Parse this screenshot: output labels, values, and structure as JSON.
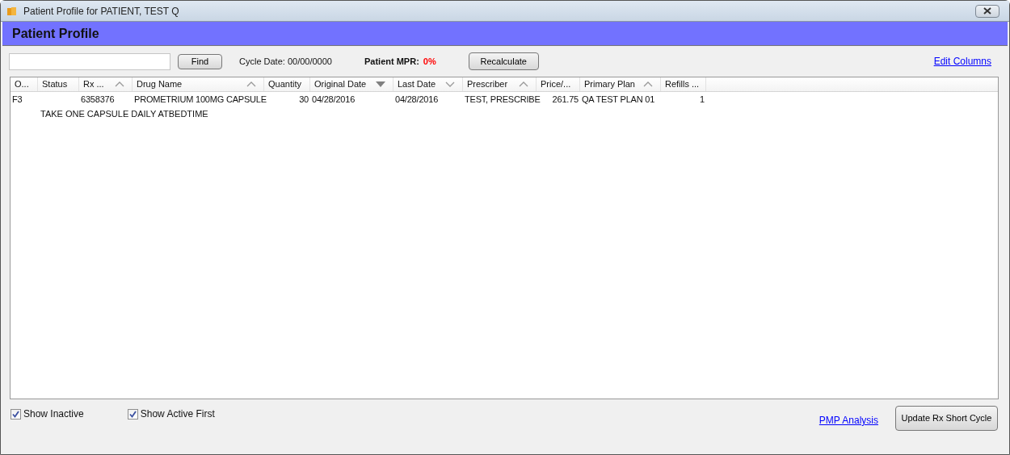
{
  "window": {
    "title": "Patient Profile for PATIENT, TEST Q"
  },
  "header": {
    "title": "Patient Profile"
  },
  "toolbar": {
    "find_button": "Find",
    "cycle_date": "Cycle Date: 00/00/0000",
    "mpr_label": "Patient MPR:",
    "mpr_value": "0%",
    "recalculate_button": "Recalculate",
    "edit_columns_link": "Edit Columns"
  },
  "table": {
    "columns": [
      {
        "label": "O...",
        "sort_arrow": false,
        "kind": "text"
      },
      {
        "label": "Status",
        "sort_arrow": false,
        "kind": "text"
      },
      {
        "label": "Rx ...",
        "sort_arrow": true,
        "descending": false,
        "active": false,
        "kind": "text"
      },
      {
        "label": "Drug Name",
        "sort_arrow": true,
        "descending": false,
        "active": false,
        "kind": "text"
      },
      {
        "label": "Quantity",
        "sort_arrow": false,
        "kind": "number"
      },
      {
        "label": "Original Date",
        "sort_arrow": true,
        "descending": true,
        "active": true,
        "kind": "text"
      },
      {
        "label": "Last Date",
        "sort_arrow": true,
        "descending": true,
        "active": false,
        "kind": "text"
      },
      {
        "label": "Prescriber",
        "sort_arrow": true,
        "descending": false,
        "active": false,
        "kind": "text"
      },
      {
        "label": "Price/...",
        "sort_arrow": false,
        "kind": "number"
      },
      {
        "label": "Primary Plan",
        "sort_arrow": true,
        "descending": false,
        "active": false,
        "kind": "text"
      },
      {
        "label": "Refills ...",
        "sort_arrow": false,
        "kind": "number"
      }
    ],
    "rows": [
      {
        "cells": [
          "F3",
          "",
          "6358376",
          "PROMETRIUM 100MG CAPSULE",
          "30",
          "04/28/2016",
          "04/28/2016",
          "TEST, PRESCRIBE",
          "261.75",
          "QA TEST PLAN 01",
          "1"
        ],
        "note": "TAKE ONE CAPSULE DAILY ATBEDTIME"
      }
    ]
  },
  "options": [
    {
      "label": "Show Inactive",
      "checked": true
    },
    {
      "label": "Show Active First",
      "checked": true
    }
  ],
  "footer": {
    "pmp_link": "PMP Analysis",
    "update_button": "Update Rx Short Cycle"
  }
}
